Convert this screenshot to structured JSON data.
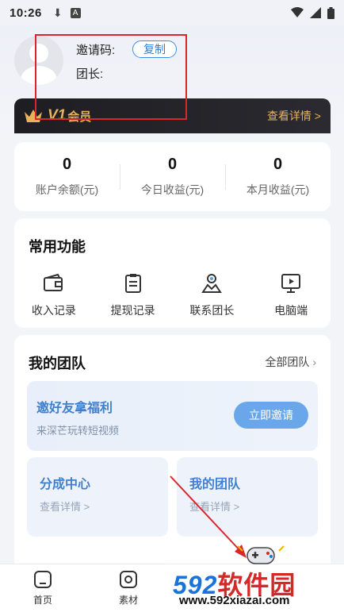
{
  "status_bar": {
    "time": "10:26",
    "icons": [
      "download-icon",
      "a-badge-icon",
      "wifi-icon",
      "signal-icon",
      "battery-icon"
    ]
  },
  "profile": {
    "invite_code_label": "邀请码:",
    "copy_label": "复制",
    "leader_label": "团长:"
  },
  "vip": {
    "level": "V1",
    "label": "会员",
    "detail": "查看详情 >",
    "accent": "#e9b25a"
  },
  "stats": [
    {
      "value": "0",
      "label": "账户余额(元)"
    },
    {
      "value": "0",
      "label": "今日收益(元)"
    },
    {
      "value": "0",
      "label": "本月收益(元)"
    }
  ],
  "functions": {
    "title": "常用功能",
    "items": [
      {
        "label": "收入记录",
        "icon": "wallet-icon"
      },
      {
        "label": "提现记录",
        "icon": "clipboard-icon"
      },
      {
        "label": "联系团长",
        "icon": "contact-icon"
      },
      {
        "label": "电脑端",
        "icon": "monitor-play-icon"
      }
    ]
  },
  "team": {
    "title": "我的团队",
    "all_link": "全部团队",
    "banner_title": "邀好友拿福利",
    "banner_sub": "来深芒玩转短视频",
    "invite_button": "立即邀请",
    "cards": [
      {
        "title": "分成中心",
        "link": "查看详情 >"
      },
      {
        "title": "我的团队",
        "link": "查看详情 >"
      }
    ]
  },
  "tabbar": [
    {
      "label": "首页",
      "icon": "home-icon"
    },
    {
      "label": "素材",
      "icon": "material-icon"
    }
  ],
  "watermark": {
    "brand_num": "592",
    "brand_cn": "软件园",
    "url": "www.592xiazai.com"
  },
  "colors": {
    "brand_blue": "#3f7fd0",
    "annotation_red": "#d9262c"
  }
}
